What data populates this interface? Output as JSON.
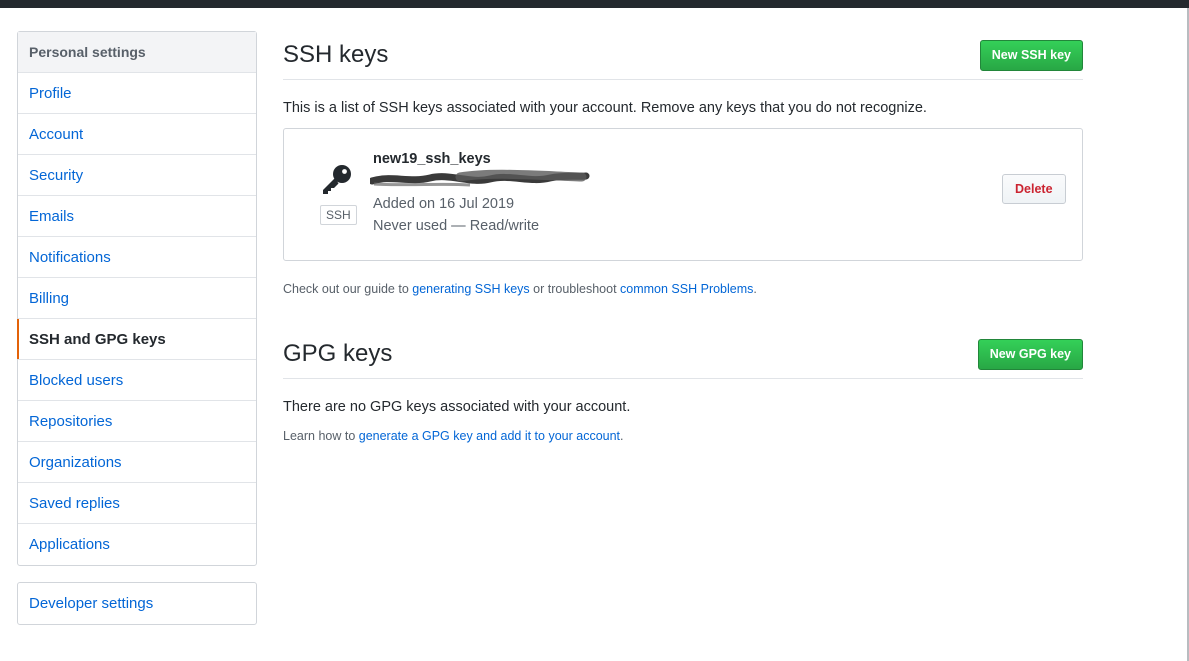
{
  "sidebar": {
    "heading": "Personal settings",
    "items": [
      {
        "label": "Profile"
      },
      {
        "label": "Account"
      },
      {
        "label": "Security"
      },
      {
        "label": "Emails"
      },
      {
        "label": "Notifications"
      },
      {
        "label": "Billing"
      },
      {
        "label": "SSH and GPG keys"
      },
      {
        "label": "Blocked users"
      },
      {
        "label": "Repositories"
      },
      {
        "label": "Organizations"
      },
      {
        "label": "Saved replies"
      },
      {
        "label": "Applications"
      }
    ],
    "selected": "SSH and GPG keys",
    "developer_settings": "Developer settings"
  },
  "ssh": {
    "title": "SSH keys",
    "new_button": "New SSH key",
    "intro": "This is a list of SSH keys associated with your account. Remove any keys that you do not recognize.",
    "key": {
      "name": "new19_ssh_keys",
      "badge": "SSH",
      "added": "Added on 16 Jul 2019",
      "usage": "Never used — Read/write",
      "delete_label": "Delete",
      "icon": "key-icon"
    },
    "help_prefix": "Check out our guide to ",
    "help_link1": "generating SSH keys",
    "help_middle": " or troubleshoot ",
    "help_link2": "common SSH Problems",
    "help_suffix": "."
  },
  "gpg": {
    "title": "GPG keys",
    "new_button": "New GPG key",
    "empty": "There are no GPG keys associated with your account.",
    "help_prefix": "Learn how to ",
    "help_link": "generate a GPG key and add it to your account",
    "help_suffix": "."
  },
  "colors": {
    "accent_green": "#2cbe4e",
    "link_blue": "#0366d6",
    "selected_bar": "#e36209",
    "danger_red": "#cb2431"
  }
}
